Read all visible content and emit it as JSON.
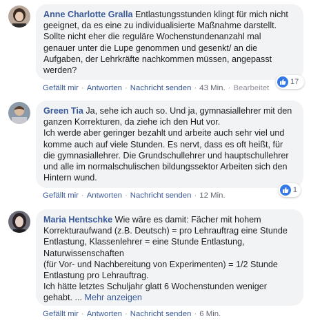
{
  "comments": [
    {
      "author": "Anne Charlotte Gralla",
      "text": "Entlastungsstunden klingt für mich nicht geeignet, da es eine zu individualisierte Maßnahme darstellt. Sollte nicht eher die reguläre Wochenstundenanzahl mal genauer unter die Lupe genommen und gesenkt/ an die Aufgaben, der Lehrkräfte nachkommen müssen, angepasst werden?",
      "like_label": "Gefällt mir",
      "reply_label": "Antworten",
      "message_label": "Nachricht senden",
      "time": "43 Min.",
      "edited": "Bearbeitet",
      "reaction_count": "17",
      "reaction_icons": [
        "like-icon",
        "heart-icon"
      ]
    },
    {
      "author": "Green Tia",
      "text": "Ja, sehe ich auch so. Und ja, gymnasiallehrer mit den ganzen Korrekturen, da ziehe ich den Hut vor.\nIch werde aber geringer bezahlt und arbeite auch sehr viel und komme auch auf viele Stunden. Es nervt, dass es oft heißt, für die gymnasiallehrer. Die Grundschullehrer und hauptschullehrer und alle im normalschulischen bildungssektor Arbeiten sich den Hintern wund.",
      "like_label": "Gefällt mir",
      "reply_label": "Antworten",
      "message_label": "Nachricht senden",
      "time": "12 Min.",
      "reaction_count": "1",
      "reaction_icons": [
        "like-icon"
      ]
    },
    {
      "author": "Maria Hentschke",
      "text": "Wie wäre es damit: Fächer mit hohem Korrekturaufwand (z.B. Deutsch) = pro Lehrauftrag eine Stunde Entlastung, Klassenlehrer = eine Stunde Entlastung, Naturwissenschaften\n(für Vor- und Nachbereitung von Experimenten) = 1/2 Stunde Entlastung pro Lehrauftrag.\nIch hätte letztes Schuljahr glatt 6 Wochenstunden weniger gehabt. ...",
      "more_label": "Mehr anzeigen",
      "like_label": "Gefällt mir",
      "reply_label": "Antworten",
      "message_label": "Nachricht senden",
      "time": "6 Min."
    }
  ],
  "colors": {
    "author": "#385898",
    "bubble": "#f2f3f5",
    "like_blue": "#3578e5",
    "heart_red": "#f25268"
  }
}
